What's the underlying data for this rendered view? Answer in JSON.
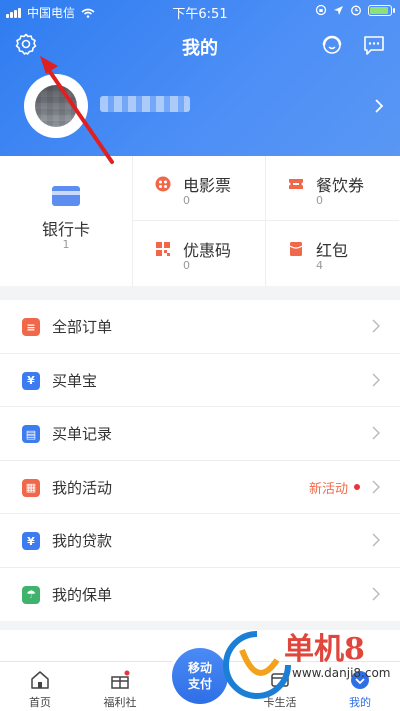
{
  "status_bar": {
    "carrier": "中国电信",
    "time": "下午6:51"
  },
  "header": {
    "title": "我的"
  },
  "assets": {
    "bank_card": {
      "label": "银行卡",
      "count": "1"
    },
    "items": [
      {
        "label": "电影票",
        "count": "0",
        "icon": "movie-ticket-icon",
        "color": "#f0674a"
      },
      {
        "label": "餐饮券",
        "count": "0",
        "icon": "food-coupon-icon",
        "color": "#f0674a"
      },
      {
        "label": "优惠码",
        "count": "0",
        "icon": "promo-code-icon",
        "color": "#f0674a"
      },
      {
        "label": "红包",
        "count": "4",
        "icon": "red-packet-icon",
        "color": "#f0674a"
      }
    ]
  },
  "menu": [
    {
      "label": "全部订单",
      "icon": "orders-icon",
      "color": "#f0674a",
      "glyph": "≡"
    },
    {
      "label": "买单宝",
      "icon": "pay-bag-icon",
      "color": "#3d7cf0",
      "glyph": "¥"
    },
    {
      "label": "买单记录",
      "icon": "record-icon",
      "color": "#3d7cf0",
      "glyph": "▤"
    },
    {
      "label": "我的活动",
      "icon": "activity-icon",
      "color": "#f0674a",
      "glyph": "▦",
      "badge": "新活动"
    },
    {
      "label": "我的贷款",
      "icon": "loan-icon",
      "color": "#3d7cf0",
      "glyph": "¥"
    },
    {
      "label": "我的保单",
      "icon": "insurance-icon",
      "color": "#3fb26b",
      "glyph": "☂"
    }
  ],
  "tabs": [
    {
      "label": "首页",
      "icon": "home-icon"
    },
    {
      "label": "福利社",
      "icon": "gift-icon"
    },
    {
      "label": "移动支付",
      "icon": "pay-icon"
    },
    {
      "label": "卡生活",
      "icon": "card-life-icon"
    },
    {
      "label": "我的",
      "icon": "profile-icon"
    }
  ],
  "center_button": {
    "line1": "移动",
    "line2": "支付"
  },
  "watermark": {
    "brand": "单机8",
    "url": "www.danji8.com"
  },
  "colors": {
    "header": "#3a84f2",
    "accent": "#2f6fe6",
    "annotation_arrow": "#e02020"
  }
}
